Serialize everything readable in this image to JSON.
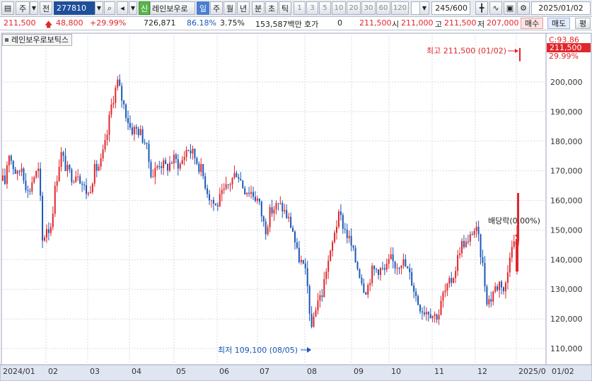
{
  "toolbar": {
    "market": "주",
    "mode": "전",
    "code": "277810",
    "shin": "신",
    "name": "레인보우로",
    "periods": [
      "일",
      "주",
      "월",
      "년",
      "분",
      "초",
      "틱"
    ],
    "intervals": [
      "1",
      "3",
      "5",
      "10",
      "20",
      "30",
      "60",
      "120"
    ],
    "count": "245/600",
    "date": "2025/01/02"
  },
  "quote": {
    "price": "211,500",
    "change": "48,800",
    "rate": "+29.99%",
    "volume": "726,871",
    "vol_ratio": "86.18%",
    "turnover": "3.75%",
    "amount": "153,587백만",
    "hoga_label": "호가",
    "hoga": "0",
    "price2": "211,500",
    "open_label": "시",
    "open": "211,000",
    "high_label": "고",
    "high": "211,500",
    "low_label": "저",
    "low": "207,000",
    "buy": "매수",
    "sell": "매도",
    "eval": "평"
  },
  "chart_title": "레인보우로보틱스",
  "chart_data": {
    "type": "candlestick",
    "x_labels": [
      "2024/01",
      "02",
      "03",
      "04",
      "05",
      "06",
      "07",
      "08",
      "09",
      "10",
      "11",
      "12",
      "2025/0",
      "01/02"
    ],
    "y_ticks": [
      110000,
      120000,
      130000,
      140000,
      150000,
      160000,
      170000,
      180000,
      190000,
      200000
    ],
    "y_tick_labels": [
      "110,000",
      "120,000",
      "130,000",
      "140,000",
      "150,000",
      "160,000",
      "170,000",
      "180,000",
      "190,000",
      "200,000"
    ],
    "ylim": [
      104000,
      215500
    ],
    "last_price": "211,500",
    "c_label": "C:93.86",
    "last_pct": "29.99%",
    "high_annotation": "최고 211,500 (01/02)",
    "low_annotation": "최저 109,100 (08/05)",
    "dividend_annotation": "배당락(0.00%)",
    "up_color": "#e0262b",
    "down_color": "#1a57b8",
    "anchors": [
      [
        0,
        172000
      ],
      [
        6,
        164000
      ],
      [
        12,
        177000
      ],
      [
        18,
        172000
      ],
      [
        25,
        168000
      ],
      [
        30,
        172000
      ],
      [
        40,
        162000
      ],
      [
        47,
        168000
      ],
      [
        55,
        170000
      ],
      [
        60,
        146000
      ],
      [
        66,
        151000
      ],
      [
        70,
        150000
      ],
      [
        72,
        152000
      ],
      [
        79,
        166000
      ],
      [
        86,
        176000
      ],
      [
        95,
        170000
      ],
      [
        103,
        168000
      ],
      [
        110,
        170000
      ],
      [
        117,
        165000
      ],
      [
        125,
        162000
      ],
      [
        133,
        170000
      ],
      [
        142,
        172000
      ],
      [
        150,
        180000
      ],
      [
        158,
        193000
      ],
      [
        166,
        200000
      ],
      [
        175,
        192000
      ],
      [
        185,
        184000
      ],
      [
        195,
        184000
      ],
      [
        205,
        180000
      ],
      [
        215,
        168000
      ],
      [
        225,
        173000
      ],
      [
        235,
        171000
      ],
      [
        245,
        174000
      ],
      [
        255,
        172000
      ],
      [
        265,
        178000
      ],
      [
        275,
        175000
      ],
      [
        285,
        170000
      ],
      [
        295,
        162000
      ],
      [
        305,
        158000
      ],
      [
        315,
        162000
      ],
      [
        325,
        166000
      ],
      [
        335,
        170000
      ],
      [
        345,
        164000
      ],
      [
        355,
        163000
      ],
      [
        365,
        160000
      ],
      [
        375,
        150000
      ],
      [
        382,
        156000
      ],
      [
        390,
        158000
      ],
      [
        398,
        158000
      ],
      [
        407,
        154000
      ],
      [
        414,
        150000
      ],
      [
        420,
        142000
      ],
      [
        428,
        138000
      ],
      [
        433,
        134000
      ],
      [
        437,
        126000
      ],
      [
        440,
        114000
      ],
      [
        443,
        120000
      ],
      [
        448,
        126000
      ],
      [
        455,
        128000
      ],
      [
        462,
        138000
      ],
      [
        468,
        142000
      ],
      [
        473,
        150000
      ],
      [
        480,
        155000
      ],
      [
        488,
        150000
      ],
      [
        495,
        146000
      ],
      [
        502,
        140000
      ],
      [
        508,
        136000
      ],
      [
        514,
        131000
      ],
      [
        519,
        130000
      ],
      [
        525,
        136000
      ],
      [
        535,
        137000
      ],
      [
        545,
        136000
      ],
      [
        552,
        140000
      ],
      [
        560,
        138000
      ],
      [
        568,
        140000
      ],
      [
        575,
        137000
      ],
      [
        582,
        133000
      ],
      [
        590,
        126000
      ],
      [
        598,
        123000
      ],
      [
        606,
        123000
      ],
      [
        614,
        121000
      ],
      [
        621,
        122000
      ],
      [
        626,
        128000
      ],
      [
        632,
        130000
      ],
      [
        640,
        134000
      ],
      [
        645,
        138000
      ],
      [
        650,
        144000
      ],
      [
        655,
        146000
      ],
      [
        662,
        145000
      ],
      [
        668,
        150000
      ],
      [
        673,
        150000
      ],
      [
        678,
        145000
      ],
      [
        683,
        137000
      ],
      [
        688,
        127000
      ],
      [
        693,
        126000
      ],
      [
        698,
        130000
      ],
      [
        703,
        131000
      ],
      [
        708,
        133000
      ],
      [
        713,
        129000
      ],
      [
        717,
        134000
      ],
      [
        721,
        143000
      ],
      [
        725,
        148000
      ],
      [
        729,
        142000
      ],
      [
        733,
        160000
      ]
    ]
  }
}
